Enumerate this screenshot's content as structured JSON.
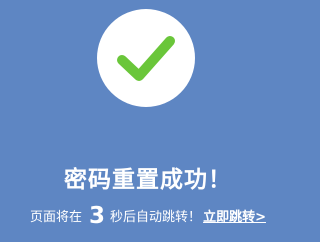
{
  "status": {
    "icon": "check-icon",
    "title": "密码重置成功！",
    "accent_color": "#6ac63a",
    "background_color": "#5e86c3"
  },
  "redirect": {
    "before_text": "页面将在",
    "seconds": "3",
    "after_text": "秒后自动跳转！",
    "link_label": "立即跳转>"
  }
}
